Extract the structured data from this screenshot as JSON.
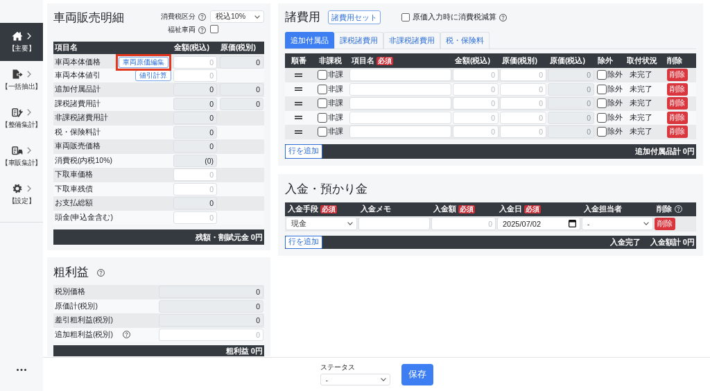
{
  "sidebar": {
    "items": [
      {
        "label": "【主要】",
        "selected": true
      },
      {
        "label": "【一括抽出】",
        "selected": false
      },
      {
        "label": "【整備集計】",
        "selected": false
      },
      {
        "label": "【車販集計】",
        "selected": false
      },
      {
        "label": "【設定】",
        "selected": false
      }
    ]
  },
  "sales_detail": {
    "title": "車両販売明細",
    "tax_type": {
      "label": "消費税区分",
      "field": {
        "kind": "select",
        "value": "税込10%"
      }
    },
    "welfare_vehicle": {
      "label": "福祉車両",
      "checked": false
    },
    "columns": [
      "項目名",
      "金額(税込)",
      "原価(税別)"
    ],
    "rows": [
      {
        "label": "車両本体価格",
        "button": {
          "label": "車両原価編集",
          "highlighted": true
        },
        "amount": {
          "kind": "input",
          "placeholder": "0"
        },
        "cost": {
          "kind": "readonly",
          "value": "0"
        }
      },
      {
        "label": "車両本体値引",
        "button": {
          "label": "値引計算",
          "highlighted": false
        },
        "amount": {
          "kind": "input",
          "placeholder": "0"
        }
      },
      {
        "label": "追加付属品計",
        "amount": {
          "kind": "readonly",
          "value": "0"
        },
        "cost": {
          "kind": "readonly",
          "value": "0"
        }
      },
      {
        "label": "課税諸費用計",
        "amount": {
          "kind": "readonly",
          "value": "0"
        },
        "cost": {
          "kind": "readonly",
          "value": "0"
        }
      },
      {
        "label": "非課税諸費用計",
        "amount": {
          "kind": "readonly",
          "value": "0"
        }
      },
      {
        "label": "税・保険料計",
        "amount": {
          "kind": "readonly",
          "value": "0"
        }
      },
      {
        "label": "車両販売価格",
        "amount": {
          "kind": "readonly",
          "value": "0"
        }
      },
      {
        "label": "消費税(内税10%)",
        "amount": {
          "kind": "readonly",
          "value": "(0)"
        }
      },
      {
        "label": "下取車価格",
        "amount": {
          "kind": "input",
          "placeholder": "0"
        }
      },
      {
        "label": "下取車残債",
        "amount": {
          "kind": "input",
          "placeholder": "0"
        }
      },
      {
        "label": "お支払総額",
        "amount": {
          "kind": "readonly",
          "value": "0"
        }
      },
      {
        "label": "頭金(申込金含む)",
        "amount": {
          "kind": "input",
          "placeholder": "0"
        }
      }
    ],
    "footer": "残額・割賦元金 0円"
  },
  "gross_profit": {
    "title": "粗利益",
    "rows": [
      {
        "label": "税別価格",
        "field": {
          "kind": "readonly",
          "value": "0"
        }
      },
      {
        "label": "原価計(税別)",
        "field": {
          "kind": "readonly",
          "value": "0"
        }
      },
      {
        "label": "差引粗利益(税別)",
        "field": {
          "kind": "readonly",
          "value": "0"
        }
      },
      {
        "label": "追加粗利益(税別)",
        "help": true,
        "field": {
          "kind": "input",
          "placeholder": "0"
        }
      }
    ],
    "footer": "粗利益 0円"
  },
  "expenses": {
    "title": "諸費用",
    "set_button": "諸費用セット",
    "cost_tax_option": {
      "label": "原価入力時に消費税減算",
      "checked": false
    },
    "tabs": [
      {
        "label": "追加付属品",
        "selected": true
      },
      {
        "label": "課税諸費用",
        "selected": false
      },
      {
        "label": "非課税諸費用",
        "selected": false
      },
      {
        "label": "税・保険料",
        "selected": false
      }
    ],
    "columns": [
      {
        "label": "順番"
      },
      {
        "label": "非課税"
      },
      {
        "label": "項目名",
        "badge": "必須"
      },
      {
        "label": "金額(税込)"
      },
      {
        "label": "原価(税別)"
      },
      {
        "label": "原価(税込)"
      },
      {
        "label": "除外"
      },
      {
        "label": "取付状況"
      },
      {
        "label": "削除"
      }
    ],
    "rows": [
      {
        "non_taxable": {
          "label": "非課",
          "checked": false
        },
        "name": {
          "kind": "input"
        },
        "amount": {
          "kind": "input",
          "placeholder": "0"
        },
        "cost": {
          "kind": "input",
          "placeholder": "0"
        },
        "cost_incl": {
          "kind": "disabled",
          "placeholder": "0"
        },
        "excluded": {
          "label": "除外",
          "checked": false
        },
        "status": "未完了",
        "delete_button": "削除"
      },
      {
        "non_taxable": {
          "label": "非課",
          "checked": false
        },
        "name": {
          "kind": "input"
        },
        "amount": {
          "kind": "input",
          "placeholder": "0"
        },
        "cost": {
          "kind": "input",
          "placeholder": "0"
        },
        "cost_incl": {
          "kind": "disabled",
          "placeholder": "0"
        },
        "excluded": {
          "label": "除外",
          "checked": false
        },
        "status": "未完了",
        "delete_button": "削除"
      },
      {
        "non_taxable": {
          "label": "非課",
          "checked": false
        },
        "name": {
          "kind": "input"
        },
        "amount": {
          "kind": "input",
          "placeholder": "0"
        },
        "cost": {
          "kind": "input",
          "placeholder": "0"
        },
        "cost_incl": {
          "kind": "disabled",
          "placeholder": "0"
        },
        "excluded": {
          "label": "除外",
          "checked": false
        },
        "status": "未完了",
        "delete_button": "削除"
      },
      {
        "non_taxable": {
          "label": "非課",
          "checked": false
        },
        "name": {
          "kind": "input"
        },
        "amount": {
          "kind": "input",
          "placeholder": "0"
        },
        "cost": {
          "kind": "input",
          "placeholder": "0"
        },
        "cost_incl": {
          "kind": "disabled",
          "placeholder": "0"
        },
        "excluded": {
          "label": "除外",
          "checked": false
        },
        "status": "未完了",
        "delete_button": "削除"
      },
      {
        "non_taxable": {
          "label": "非課",
          "checked": false
        },
        "name": {
          "kind": "input"
        },
        "amount": {
          "kind": "input",
          "placeholder": "0"
        },
        "cost": {
          "kind": "input",
          "placeholder": "0"
        },
        "cost_incl": {
          "kind": "disabled",
          "placeholder": "0"
        },
        "excluded": {
          "label": "除外",
          "checked": false
        },
        "status": "未完了",
        "delete_button": "削除"
      }
    ],
    "add_row_button": "行を追加",
    "total": "追加付属品計 0円"
  },
  "payments": {
    "title": "入金・預かり金",
    "columns": [
      {
        "label": "入金手段",
        "badge": "必須"
      },
      {
        "label": "入金メモ"
      },
      {
        "label": "入金額",
        "badge": "必須"
      },
      {
        "label": "入金日",
        "badge": "必須"
      },
      {
        "label": "入金担当者"
      },
      {
        "label": "削除",
        "help": true
      }
    ],
    "rows": [
      {
        "method": {
          "kind": "select",
          "value": "現金"
        },
        "memo": {
          "kind": "input"
        },
        "amount": {
          "kind": "input",
          "placeholder": "0"
        },
        "date": {
          "kind": "date",
          "value": "2025/07/02"
        },
        "staff": {
          "kind": "select",
          "value": "-"
        },
        "delete_button": "削除"
      }
    ],
    "add_row_button": "行を追加",
    "status": "入金完了",
    "total": "入金額計 0円"
  },
  "bottom_bar": {
    "status_label": "ステータス",
    "status_field": {
      "kind": "select",
      "value": "-"
    },
    "save_button": "保存"
  }
}
